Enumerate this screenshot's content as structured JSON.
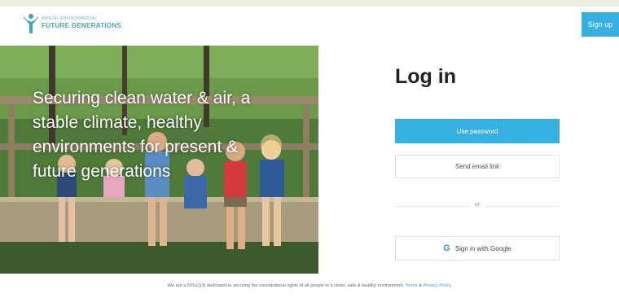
{
  "brand": {
    "line1": "ANNUAL ENVIRONMENTAL",
    "line2": "FUTURE GENERATIONS",
    "line3": "",
    "accent": "#3fa7b3"
  },
  "header": {
    "signup_label": "Sign up"
  },
  "hero": {
    "tagline": "Securing clean water & air, a stable climate, healthy environments for present & future generations"
  },
  "login": {
    "title": "Log in",
    "password_button": "Use password",
    "email_button": "Send email link",
    "divider": "or",
    "google_button": "Sign in with Google"
  },
  "footer": {
    "text": "We are a 501(c)(3) dedicated to securing the constitutional rights of all people to a clean, safe & healthy environment.",
    "terms": "Terms",
    "and": "&",
    "privacy": "Privacy Policy"
  },
  "colors": {
    "primary": "#35b0e0",
    "top_strip": "#e9efdf"
  }
}
